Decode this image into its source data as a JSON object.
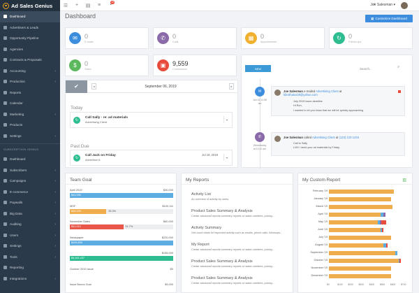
{
  "app": {
    "name": "Ad Sales Genius"
  },
  "sidebar": {
    "primary": [
      {
        "label": "Dashboard",
        "icon": "home-icon",
        "active": true,
        "chevron": false
      },
      {
        "label": "Advertisers & Leads",
        "icon": "users-icon",
        "chevron": false
      },
      {
        "label": "Opportunity Pipeline",
        "icon": "pipeline-icon",
        "chevron": false
      },
      {
        "label": "Agencies",
        "icon": "building-icon",
        "chevron": false
      },
      {
        "label": "Contracts & Proposals",
        "icon": "contract-icon",
        "chevron": false
      },
      {
        "label": "Accounting",
        "icon": "dollar-icon",
        "chevron": true
      },
      {
        "label": "Production",
        "icon": "production-icon",
        "chevron": true
      },
      {
        "label": "Reports",
        "icon": "report-icon",
        "chevron": false
      },
      {
        "label": "Calendar",
        "icon": "calendar-icon",
        "chevron": false
      },
      {
        "label": "Marketing",
        "icon": "megaphone-icon",
        "chevron": true
      },
      {
        "label": "Products",
        "icon": "box-icon",
        "chevron": false
      },
      {
        "label": "Settings",
        "icon": "gear-icon",
        "chevron": true
      }
    ],
    "section_label": "SUBSCRIPTION GENIUS",
    "secondary": [
      {
        "label": "Dashboard",
        "icon": "home-icon",
        "chevron": false
      },
      {
        "label": "Subscribers",
        "icon": "users-icon",
        "chevron": true
      },
      {
        "label": "Campaigns",
        "icon": "campaign-icon",
        "chevron": true
      },
      {
        "label": "E-commerce",
        "icon": "cart-icon",
        "chevron": true
      },
      {
        "label": "Paywalls",
        "icon": "lock-icon",
        "chevron": true
      },
      {
        "label": "Big Data",
        "icon": "database-icon",
        "chevron": true
      },
      {
        "label": "Auditing",
        "icon": "audit-icon",
        "chevron": true
      },
      {
        "label": "Users",
        "icon": "user-icon",
        "chevron": true
      },
      {
        "label": "Settings",
        "icon": "gear-icon",
        "chevron": true
      },
      {
        "label": "Tools",
        "icon": "wrench-icon",
        "chevron": true
      },
      {
        "label": "Reporting",
        "icon": "report-icon",
        "chevron": false
      },
      {
        "label": "Integrations",
        "icon": "plug-icon",
        "chevron": true
      }
    ]
  },
  "topbar": {
    "user": "Joe Salesman",
    "notifications": "12",
    "user_caret": "▾"
  },
  "page": {
    "title": "Dashboard",
    "customize_label": "Customize Dashboard"
  },
  "stats": [
    {
      "value": "0",
      "label": "E-mails",
      "color": "#3c8dde",
      "icon": "envelope-icon",
      "glyph": "✉"
    },
    {
      "value": "0",
      "label": "Calls",
      "color": "#8a6aa8",
      "icon": "phone-icon",
      "glyph": "✆"
    },
    {
      "value": "0",
      "label": "Appointments",
      "color": "#f0b030",
      "icon": "calendar-icon",
      "glyph": "▦"
    },
    {
      "value": "0",
      "label": "Follow-ups",
      "color": "#2ebd91",
      "icon": "refresh-icon",
      "glyph": "↻"
    },
    {
      "value": "0",
      "label": "Sales",
      "color": "#5cb85c",
      "icon": "dollar-icon",
      "glyph": "$"
    },
    {
      "value": "9,559",
      "label": "Commission",
      "color": "#e74c3c",
      "icon": "money-icon",
      "glyph": "▣"
    }
  ],
  "calendar": {
    "date": "September 06, 2019",
    "today_label": "Today",
    "past_due_label": "Past Due",
    "today_task": {
      "title": "Call Sally - re: ad materials",
      "sub": "Advertising Client"
    },
    "past_task": {
      "title": "Call Jack on Friday",
      "sub": "Advertiser A",
      "date": "Jul 19, 2019"
    }
  },
  "activity": {
    "new_label": "NEW",
    "search_placeholder": "Search...",
    "items": [
      {
        "date1": "Jan 16 11:58",
        "date2": "am",
        "actor": "Joe Salesman",
        "verb": "e-mailed",
        "target": "Advertising Client",
        "at": "at",
        "contact": "kbrothalus29@yahoo.com",
        "body": [
          "July 2019 Issue deadline",
          "Hi Ron,",
          "I wanted to let you know that we will be quickly approaching"
        ]
      },
      {
        "date1": "Wednesday",
        "date2": "at 10:41 am",
        "actor": "Joe Salesman",
        "verb": "called",
        "target": "Advertising Client",
        "at": "at",
        "contact": "(123) 123-1234",
        "body": [
          "Call to Sally",
          "LVM I need your ad materials by Friday."
        ]
      }
    ]
  },
  "team_goal": {
    "title": "Team Goal",
    "rows": [
      {
        "label": "April 2019",
        "target": "$30,000",
        "value_label": "$43,256",
        "fill": 1.0,
        "color": "#5dade2",
        "pct": ""
      },
      {
        "label": "MSF",
        "target": "$100,111",
        "value_label": "$35,335",
        "fill": 0.353,
        "color": "#f0ad4e",
        "pct": "35.3%"
      },
      {
        "label": "November Sales",
        "target": "$60,000",
        "value_label": "$31,012",
        "fill": 0.517,
        "color": "#e8574a",
        "pct": "51.7%"
      },
      {
        "label": "Newspaper",
        "target": "$220,000",
        "value_label": "$439,890",
        "fill": 1.0,
        "color": "#5dade2",
        "pct": ""
      },
      {
        "label": "",
        "target": "$155,000",
        "value_label": "$4,161,437",
        "fill": 1.0,
        "color": "#2ebd91",
        "pct": ""
      },
      {
        "label": "October 2019 Issue",
        "target": "$0",
        "value_label": "",
        "fill": 0.0,
        "color": "#5dade2",
        "pct": ""
      },
      {
        "label": "Issue Bonus Goal",
        "target": "$3,000",
        "value_label": "",
        "fill": 0.0,
        "color": "#5dade2",
        "pct": ""
      }
    ]
  },
  "my_reports": {
    "title": "My Reports",
    "items": [
      {
        "title": "Activity List",
        "desc": "An overview of activity by users."
      },
      {
        "title": "Product Sales Summary & Analysis",
        "desc": "Create advanced reports summary reports on sales numbers, pricing..."
      },
      {
        "title": "Activity Summary",
        "desc": "Get count totals for important activity such as emails, phone calls, followups..."
      },
      {
        "title": "My Report",
        "desc": "Create advanced reports summary reports on sales numbers, pricing..."
      },
      {
        "title": "Product Sales Summary & Analysis",
        "desc": "Create advanced reports summary reports on sales numbers, pricing..."
      },
      {
        "title": "Product Sales Summary & Analysis",
        "desc": "Create advanced reports summary reports on sales numbers, pricing..."
      }
    ]
  },
  "custom_report": {
    "title": "My Custom Report",
    "chart_icon": "bar-chart-icon"
  },
  "chart_data": {
    "type": "bar",
    "orientation": "horizontal",
    "stacked": true,
    "categories": [
      "February '19",
      "January '19",
      "March '19",
      "April '19",
      "May '19",
      "June '19",
      "July '19",
      "August '19",
      "September '19",
      "October '19",
      "November '19",
      "December '19"
    ],
    "series": [
      {
        "color": "#f0ad4e",
        "values": [
          88,
          84,
          86,
          70,
          66,
          70,
          84,
          74,
          90,
          94,
          84,
          84
        ]
      },
      {
        "color": "#5dade2",
        "values": [
          0,
          0,
          0,
          4,
          3,
          2,
          0,
          3,
          2,
          1,
          0,
          0
        ]
      },
      {
        "color": "#8a6aa8",
        "values": [
          0,
          0,
          0,
          2,
          2,
          0,
          0,
          0,
          0,
          0,
          0,
          0
        ]
      },
      {
        "color": "#e74c3c",
        "values": [
          0,
          0,
          0,
          0,
          6,
          2,
          0,
          2,
          0,
          2,
          0,
          0
        ]
      },
      {
        "color": "#2ebd91",
        "values": [
          0,
          0,
          0,
          0,
          0,
          0,
          0,
          0,
          0,
          0,
          0,
          0
        ]
      }
    ],
    "xlim": [
      0,
      100
    ],
    "x_ticks": [
      "$0",
      "$100",
      "$200",
      "$300",
      "$400",
      "$500",
      "$600",
      "$700"
    ],
    "grid": false
  }
}
